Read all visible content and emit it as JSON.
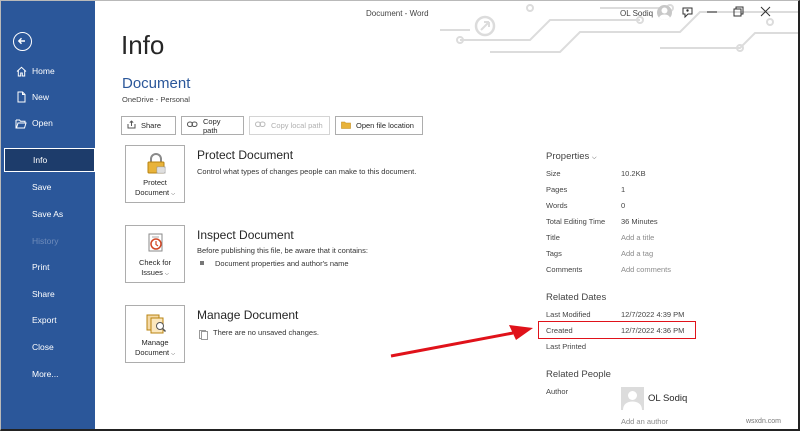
{
  "window": {
    "title": "Document  -  Word",
    "user_name": "OL Sodiq"
  },
  "sidebar": {
    "items": [
      {
        "label": "Home"
      },
      {
        "label": "New"
      },
      {
        "label": "Open"
      },
      {
        "label": "Info"
      },
      {
        "label": "Save"
      },
      {
        "label": "Save As"
      },
      {
        "label": "History"
      },
      {
        "label": "Print"
      },
      {
        "label": "Share"
      },
      {
        "label": "Export"
      },
      {
        "label": "Close"
      },
      {
        "label": "More..."
      }
    ]
  },
  "main": {
    "title": "Info",
    "doc_name": "Document",
    "doc_location": "OneDrive - Personal",
    "buttons": {
      "share": "Share",
      "copy_path": "Copy path",
      "copy_local_path": "Copy local path",
      "open_location": "Open file location"
    },
    "sections": [
      {
        "btn_line1": "Protect",
        "btn_line2": "Document",
        "title": "Protect Document",
        "desc": "Control what types of changes people can make to this document."
      },
      {
        "btn_line1": "Check for",
        "btn_line2": "Issues",
        "title": "Inspect Document",
        "desc": "Before publishing this file, be aware that it contains:",
        "bullet": "Document properties and author's name"
      },
      {
        "btn_line1": "Manage",
        "btn_line2": "Document",
        "title": "Manage Document",
        "desc": "There are no unsaved changes."
      }
    ]
  },
  "properties": {
    "heading": "Properties",
    "rows": [
      {
        "label": "Size",
        "value": "10.2KB"
      },
      {
        "label": "Pages",
        "value": "1"
      },
      {
        "label": "Words",
        "value": "0"
      },
      {
        "label": "Total Editing Time",
        "value": "36 Minutes"
      },
      {
        "label": "Title",
        "value": "Add a title"
      },
      {
        "label": "Tags",
        "value": "Add a tag"
      },
      {
        "label": "Comments",
        "value": "Add comments"
      }
    ],
    "related_dates_heading": "Related Dates",
    "dates": [
      {
        "label": "Last Modified",
        "value": "12/7/2022 4:39 PM"
      },
      {
        "label": "Created",
        "value": "12/7/2022 4:36 PM"
      },
      {
        "label": "Last Printed",
        "value": ""
      }
    ],
    "related_people_heading": "Related People",
    "author_label": "Author",
    "author_name": "OL Sodiq",
    "add_author": "Add an author"
  },
  "watermark": "wsxdn.com",
  "colors": {
    "sidebar_bg": "#2b579a",
    "sidebar_active_bg": "#1d3c6b",
    "accent_text": "#2b579a",
    "highlight_red": "#e0121a"
  }
}
